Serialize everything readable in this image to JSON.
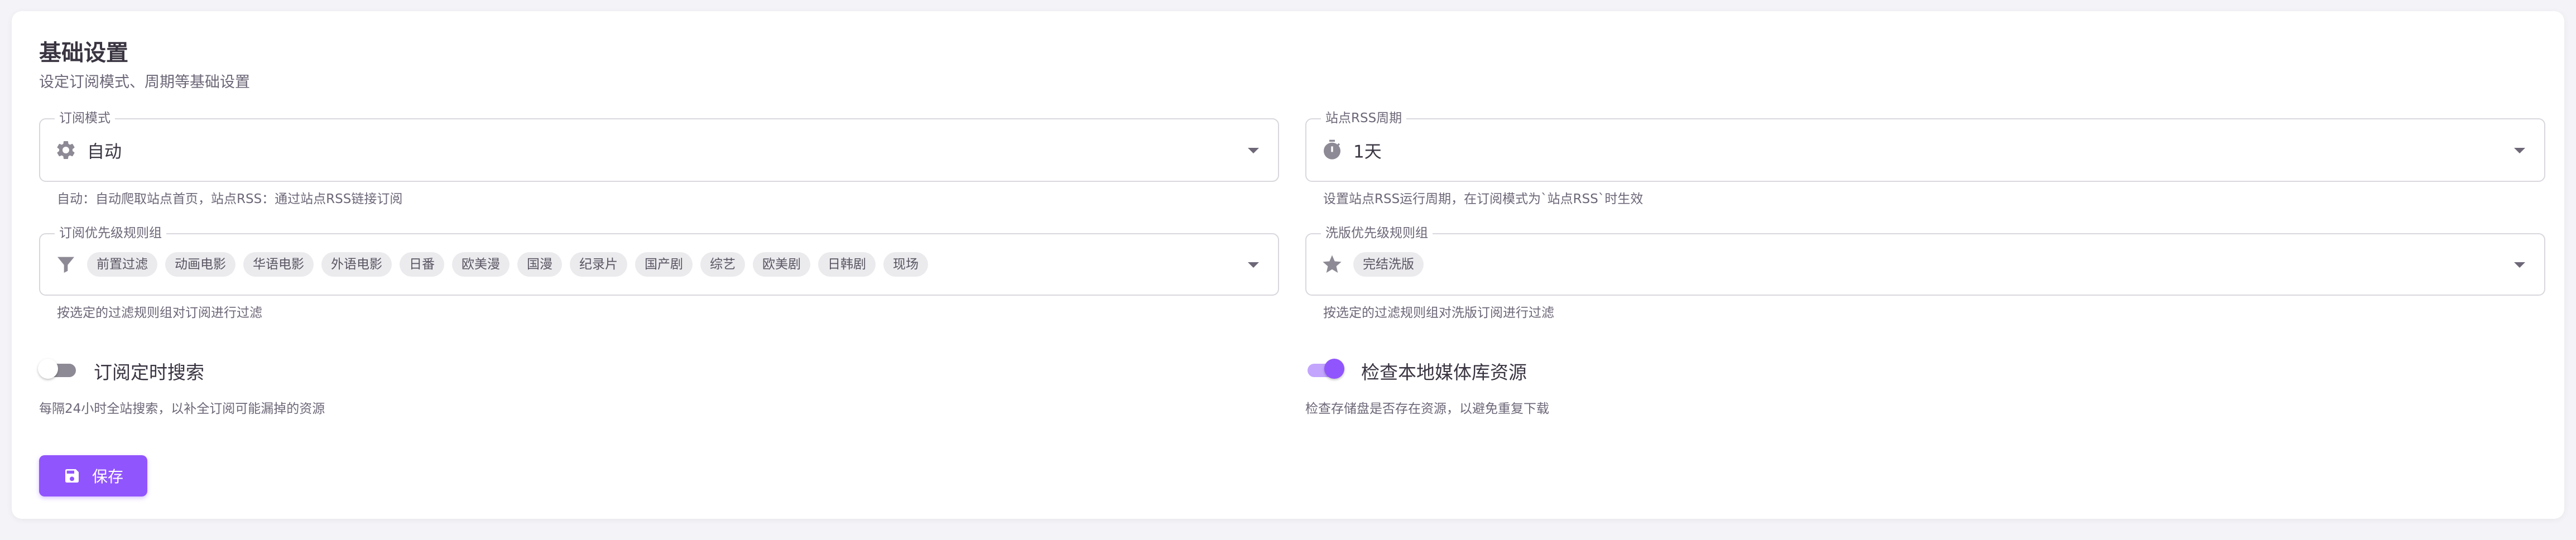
{
  "section": {
    "title": "基础设置",
    "subtitle": "设定订阅模式、周期等基础设置"
  },
  "subscribe_mode": {
    "label": "订阅模式",
    "value": "自动",
    "icon": "gear-icon",
    "hint": "自动：自动爬取站点首页，站点RSS：通过站点RSS链接订阅"
  },
  "rss_period": {
    "label": "站点RSS周期",
    "value": "1天",
    "icon": "stopwatch-icon",
    "hint": "设置站点RSS运行周期，在订阅模式为`站点RSS`时生效"
  },
  "priority_rules": {
    "label": "订阅优先级规则组",
    "icon": "filter-icon",
    "chips": [
      "前置过滤",
      "动画电影",
      "华语电影",
      "外语电影",
      "日番",
      "欧美漫",
      "国漫",
      "纪录片",
      "国产剧",
      "综艺",
      "欧美剧",
      "日韩剧",
      "现场"
    ],
    "hint": "按选定的过滤规则组对订阅进行过滤"
  },
  "wash_rules": {
    "label": "洗版优先级规则组",
    "icon": "star-icon",
    "chips": [
      "完结洗版"
    ],
    "hint": "按选定的过滤规则组对洗版订阅进行过滤"
  },
  "timed_search": {
    "label": "订阅定时搜索",
    "enabled": false,
    "hint": "每隔24小时全站搜索，以补全订阅可能漏掉的资源"
  },
  "check_local": {
    "label": "检查本地媒体库资源",
    "enabled": true,
    "hint": "检查存储盘是否存在资源，以避免重复下载"
  },
  "save_button": {
    "label": "保存",
    "icon": "save-icon"
  },
  "colors": {
    "primary": "#9155fd",
    "text": "#3a3541",
    "muted": "#6d6777",
    "border": "#d9d7dd",
    "chip_bg": "#ebebee"
  }
}
